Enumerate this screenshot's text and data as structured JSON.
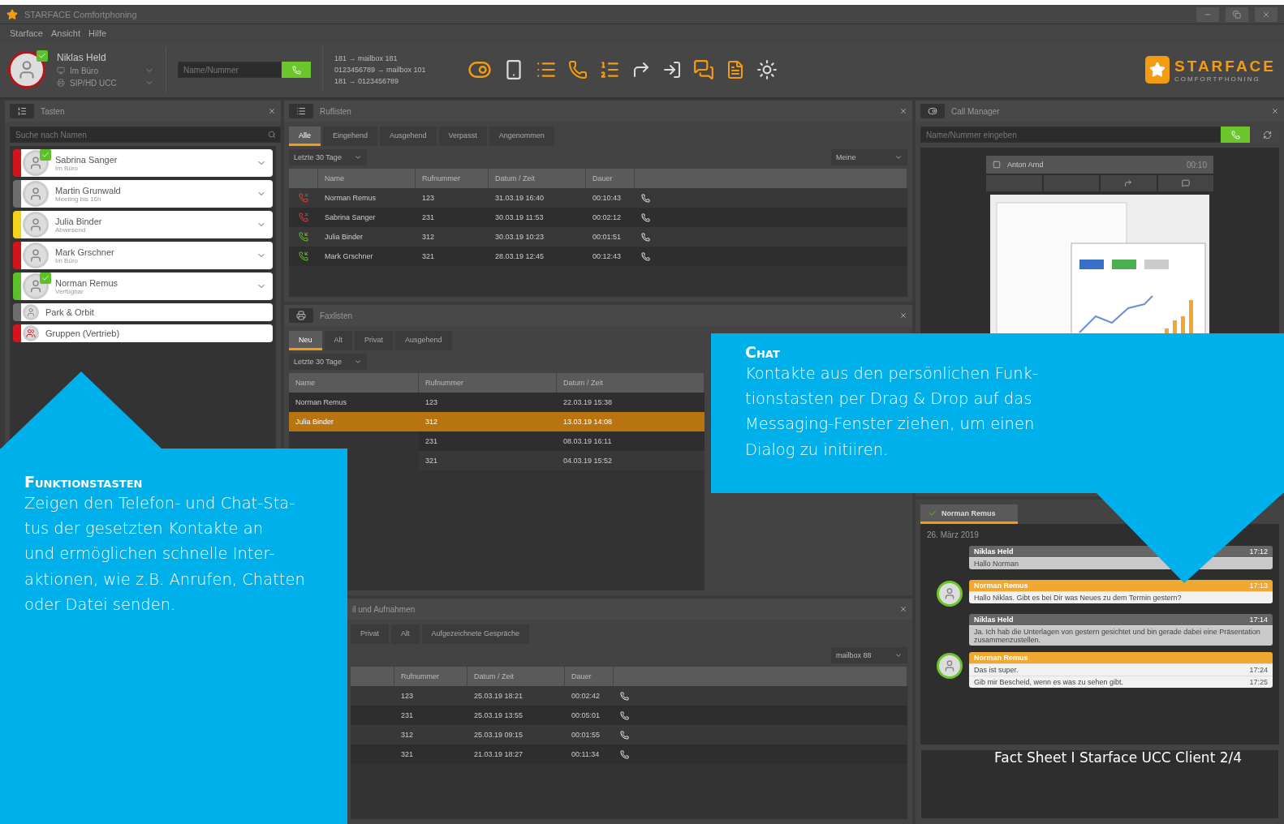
{
  "window": {
    "title": "STARFACE Comfortphoning"
  },
  "menu": [
    {
      "label": "Starface"
    },
    {
      "label": "Ansicht"
    },
    {
      "label": "Hilfe"
    }
  ],
  "user": {
    "name": "Niklas Held",
    "status": "Im Büro",
    "device": "SIP/HD UCC",
    "chat_online": true
  },
  "dial": {
    "placeholder": "Name/Nummer"
  },
  "redirects": [
    "181 → mailbox 181",
    "0123456789 → mailbox 101",
    "181 → 0123456789"
  ],
  "logo": {
    "name": "STARFACE",
    "tagline": "COMFORTPHONING"
  },
  "keys_panel": {
    "title": "Tasten",
    "search": {
      "placeholder": "Suche nach Namen"
    },
    "contacts": [
      {
        "kind": "person",
        "name": "Sabrina Sanger",
        "status": "Im Büro",
        "color": "#d0161b",
        "chat_online": true
      },
      {
        "kind": "person",
        "name": "Martin Grunwald",
        "status": "Meeting bis 16h",
        "color": "#6d6d6d",
        "chat_online": false
      },
      {
        "kind": "person",
        "name": "Julia Binder",
        "status": "Abwesend",
        "color": "#f2d21f",
        "chat_online": false
      },
      {
        "kind": "person",
        "name": "Mark Grschner",
        "status": "Im Büro",
        "color": "#d0161b",
        "chat_online": false
      },
      {
        "kind": "person",
        "name": "Norman Remus",
        "status": "Verfügbar",
        "color": "#5cc02b",
        "chat_online": true
      },
      {
        "kind": "park",
        "name": "Park & Orbit",
        "color": "#6d6d6d"
      },
      {
        "kind": "group",
        "name": "Gruppen (Vertrieb)",
        "color": "#d0161b"
      }
    ]
  },
  "calllist": {
    "title": "Ruflisten",
    "tabs": [
      {
        "label": "Alle",
        "selected": true
      },
      {
        "label": "Eingehend",
        "selected": false
      },
      {
        "label": "Ausgehend",
        "selected": false
      },
      {
        "label": "Verpasst",
        "selected": false
      },
      {
        "label": "Angenommen",
        "selected": false
      }
    ],
    "period": "Letzte 30 Tage",
    "filter": "Meine",
    "columns": [
      "Name",
      "Rufnummer",
      "Datum / Zeit",
      "Dauer"
    ],
    "rows": [
      {
        "kind": "missed",
        "cells": [
          "Norman Remus",
          "123",
          "31.03.19 16:40",
          "00:10:43"
        ]
      },
      {
        "kind": "missed",
        "cells": [
          "Sabrina Sanger",
          "231",
          "30.03.19 11:53",
          "00:02:12"
        ]
      },
      {
        "kind": "answered",
        "cells": [
          "Julia Binder",
          "312",
          "30.03.19 10:23",
          "00:01:51"
        ]
      },
      {
        "kind": "answered",
        "cells": [
          "Mark Grschner",
          "321",
          "28.03.19 12:45",
          "00:12:43"
        ]
      }
    ]
  },
  "faxlist": {
    "title": "Faxlisten",
    "tabs": [
      {
        "label": "Neu",
        "selected": true
      },
      {
        "label": "Alt",
        "selected": false
      },
      {
        "label": "Privat",
        "selected": false
      },
      {
        "label": "Ausgehend",
        "selected": false
      }
    ],
    "period": "Letzte 30 Tage",
    "columns": [
      "Name",
      "Rufnummer",
      "Datum / Zeit"
    ],
    "rows": [
      {
        "selected": false,
        "name": "Norman Remus",
        "number": "123",
        "date": "22.03.19 15:38"
      },
      {
        "selected": true,
        "name": "Julia Binder",
        "number": "312",
        "date": "13.03.19 14:08"
      },
      {
        "selected": false,
        "number": "231",
        "date": "08.03.19 16:11"
      },
      {
        "selected": false,
        "number": "321",
        "date": "04.03.19 15:52"
      }
    ]
  },
  "voicemail": {
    "title": "il und Aufnahmen",
    "tabs": [
      {
        "label": "Privat",
        "selected": false
      },
      {
        "label": "Alt",
        "selected": false
      },
      {
        "label": "Aufgezeichnete Gespräche",
        "selected": false
      }
    ],
    "filter": "mailbox 88",
    "columns": [
      "Rufnummer",
      "Datum / Zeit",
      "Dauer"
    ],
    "rows": [
      [
        "123",
        "25.03.19 18:21",
        "00:02:42"
      ],
      [
        "231",
        "25.03.19 13:55",
        "00:05:01"
      ],
      [
        "312",
        "25.03.19 09:15",
        "00:01:55"
      ],
      [
        "321",
        "21.03.19 18:27",
        "00:11:34"
      ]
    ]
  },
  "call_manager": {
    "title": "Call Manager",
    "placeholder": "Name/Nummer eingeben",
    "active_call": {
      "name": "Anton Arnd",
      "duration": "00:10"
    }
  },
  "chat": {
    "tab": "Norman Remus",
    "date": "26. März 2019",
    "messages": [
      {
        "kind": "own",
        "author": "Niklas Held",
        "time": "17:12",
        "texts": [
          {
            "text": "Hallo Norman"
          }
        ]
      },
      {
        "kind": "other",
        "author": "Norman Remus",
        "time": "17:13",
        "texts": [
          {
            "text": "Hallo Niklas. Gibt es bei Dir was Neues zu dem Termin gestern?"
          }
        ]
      },
      {
        "kind": "own",
        "author": "Niklas Held",
        "time": "17:14",
        "texts": [
          {
            "text": "Ja. Ich hab die Unterlagen von gestern gesichtet und bin gerade dabei eine Präsentation zusammenzustellen."
          }
        ]
      },
      {
        "kind": "other",
        "author": "Norman Remus",
        "texts": [
          {
            "text": "Das ist super.",
            "time": "17:24"
          },
          {
            "text": "Gib mir Bescheid, wenn es was zu sehen gibt.",
            "time": "17:25"
          }
        ]
      }
    ]
  },
  "callouts": [
    {
      "kind": "left",
      "title": "Funktionstasten",
      "lines": [
        "Zeigen den Telefon- und Chat-Sta-",
        "tus der gesetzten Kontakte an",
        "und ermöglichen schnelle Inter-",
        "aktionen, wie z.B. Anrufen, Chatten",
        "oder Datei senden."
      ]
    },
    {
      "kind": "right",
      "title": "Chat",
      "lines": [
        "Kontakte aus den persönlichen Funk-",
        "tionstasten per Drag & Drop auf das",
        "Messaging-Fenster ziehen, um einen",
        "Dialog zu initiiren."
      ]
    }
  ],
  "footer": "Fact Sheet I Starface UCC Client 2/4"
}
